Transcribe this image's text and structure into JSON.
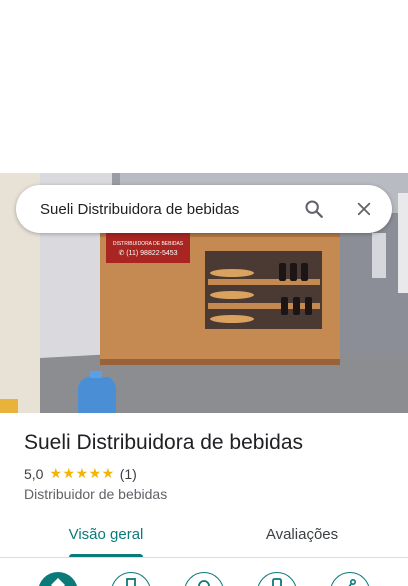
{
  "search": {
    "query": "Sueli Distribuidora de bebidas",
    "search_icon": "search-icon",
    "close_icon": "close-icon"
  },
  "photo": {
    "sign_line1": "DISTRIBUIDORA DE BEBIDAS",
    "sign_phone": "✆ (11) 98822-5453"
  },
  "place": {
    "title": "Sueli Distribuidora de bebidas",
    "rating": "5,0",
    "stars": "★★★★★",
    "review_count": "(1)",
    "category": "Distribuidor de bebidas"
  },
  "tabs": [
    {
      "label": "Visão geral",
      "selected": true
    },
    {
      "label": "Avaliações",
      "selected": false
    }
  ],
  "actions": [
    {
      "icon": "directions-icon"
    },
    {
      "icon": "save-icon"
    },
    {
      "icon": "nearby-icon"
    },
    {
      "icon": "phone-icon"
    },
    {
      "icon": "share-icon"
    }
  ],
  "colors": {
    "accent": "#0b7a79",
    "star": "#f4b400"
  }
}
